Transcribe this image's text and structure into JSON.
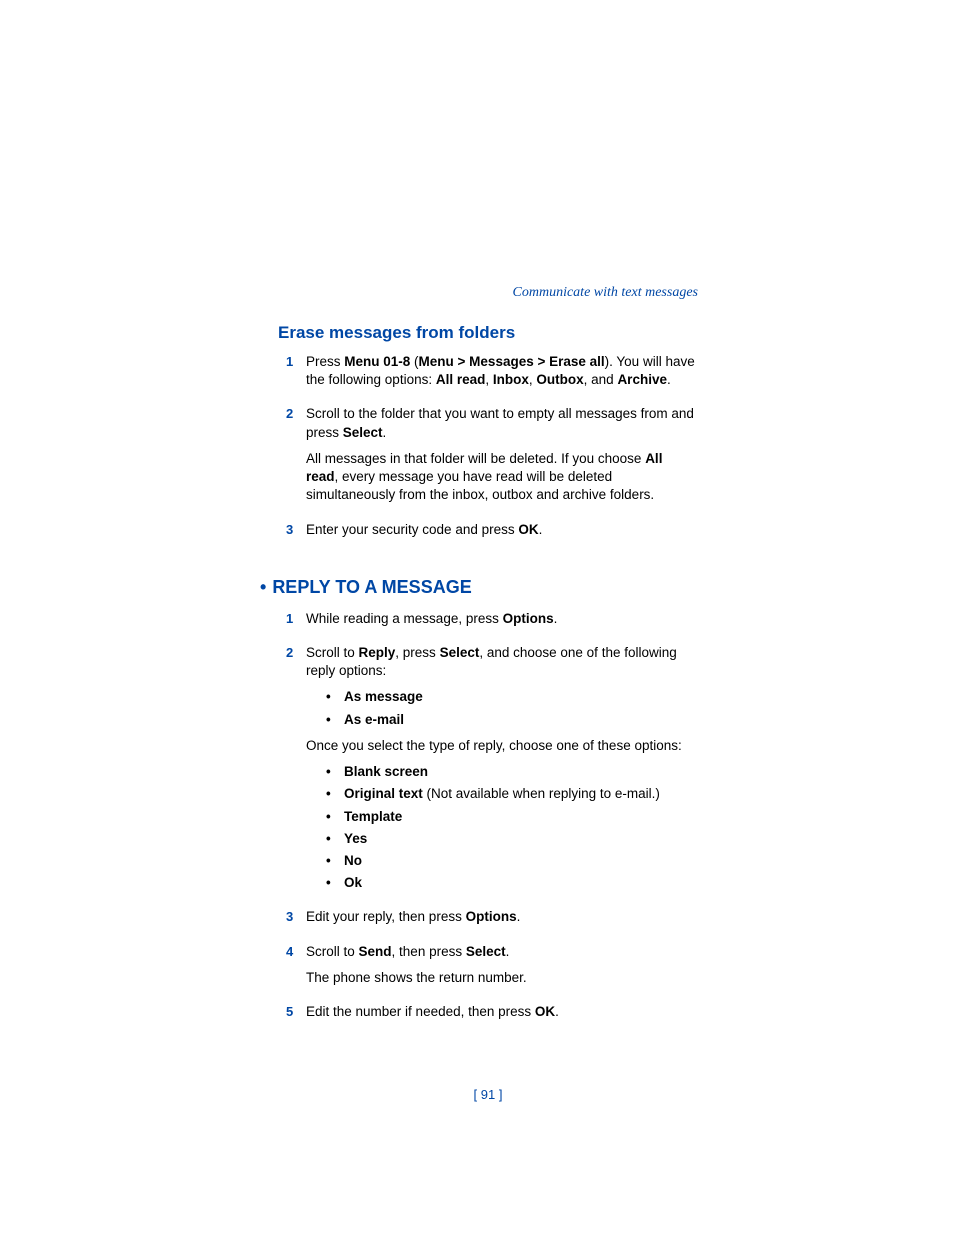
{
  "header": "Communicate with text messages",
  "section1": {
    "heading": "Erase messages from folders",
    "steps": [
      {
        "num": "1",
        "parts": [
          "Press ",
          "Menu 01-8",
          " (",
          "Menu > Messages > Erase all",
          "). You will have the following options: ",
          "All read",
          ", ",
          "Inbox",
          ", ",
          "Outbox",
          ", and ",
          "Archive",
          "."
        ]
      },
      {
        "num": "2",
        "parts": [
          "Scroll to the folder that you want to empty all messages from and press ",
          "Select",
          "."
        ],
        "after": [
          "All messages in that folder will be deleted. If you choose ",
          "All read",
          ", every message you have read will be deleted simultaneously from the inbox, outbox and archive folders."
        ]
      },
      {
        "num": "3",
        "parts": [
          "Enter your security code and press ",
          "OK",
          "."
        ]
      }
    ]
  },
  "section2": {
    "heading": "REPLY TO A MESSAGE",
    "bullet": "•",
    "steps": [
      {
        "num": "1",
        "parts": [
          "While reading a message, press ",
          "Options",
          "."
        ]
      },
      {
        "num": "2",
        "parts": [
          "Scroll to ",
          "Reply",
          ", press ",
          "Select",
          ", and choose one of the following reply options:"
        ],
        "sublist1": [
          "As message",
          "As e-mail"
        ],
        "mid": "Once you select the type of reply, choose one of these options:",
        "sublist2": [
          {
            "b": "Blank screen",
            "rest": ""
          },
          {
            "b": "Original text",
            "rest": " (Not available when replying to e-mail.)"
          },
          {
            "b": "Template",
            "rest": ""
          },
          {
            "b": "Yes",
            "rest": ""
          },
          {
            "b": "No",
            "rest": ""
          },
          {
            "b": "Ok",
            "rest": ""
          }
        ]
      },
      {
        "num": "3",
        "parts": [
          "Edit your reply, then press ",
          "Options",
          "."
        ]
      },
      {
        "num": "4",
        "parts": [
          "Scroll to ",
          "Send",
          ", then press ",
          "Select",
          "."
        ],
        "after_plain": "The phone shows the return number."
      },
      {
        "num": "5",
        "parts": [
          "Edit the number if needed, then press ",
          "OK",
          "."
        ]
      }
    ]
  },
  "page_num": "[ 91 ]"
}
